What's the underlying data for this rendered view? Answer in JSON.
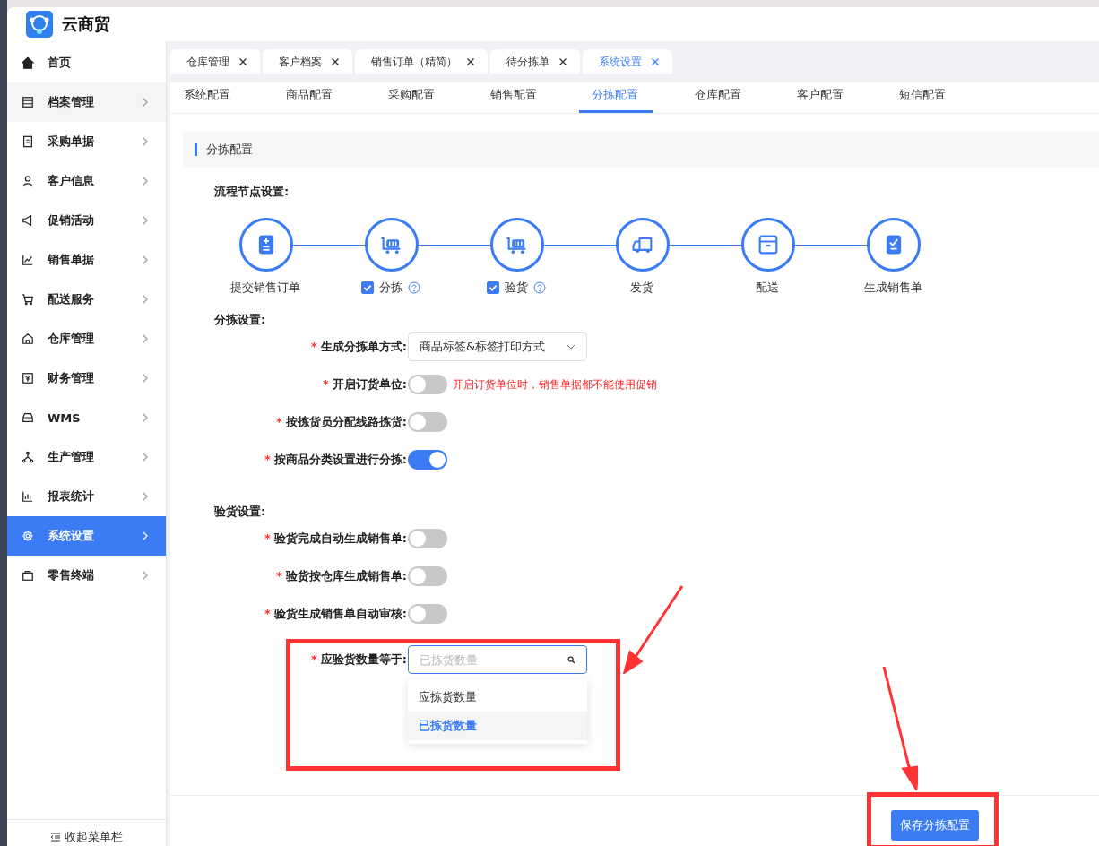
{
  "app": {
    "name": "云商贸"
  },
  "sidebar": {
    "items": [
      {
        "label": "首页",
        "selected": false,
        "expandable": false
      },
      {
        "label": "档案管理",
        "selected": false,
        "expandable": true
      },
      {
        "label": "采购单据",
        "selected": false,
        "expandable": true
      },
      {
        "label": "客户信息",
        "selected": false,
        "expandable": true
      },
      {
        "label": "促销活动",
        "selected": false,
        "expandable": true
      },
      {
        "label": "销售单据",
        "selected": false,
        "expandable": true
      },
      {
        "label": "配送服务",
        "selected": false,
        "expandable": true
      },
      {
        "label": "仓库管理",
        "selected": false,
        "expandable": true
      },
      {
        "label": "财务管理",
        "selected": false,
        "expandable": true
      },
      {
        "label": "WMS",
        "selected": false,
        "expandable": true
      },
      {
        "label": "生产管理",
        "selected": false,
        "expandable": true
      },
      {
        "label": "报表统计",
        "selected": false,
        "expandable": true
      },
      {
        "label": "系统设置",
        "selected": true,
        "expandable": true
      },
      {
        "label": "零售终端",
        "selected": false,
        "expandable": true
      }
    ],
    "collapse_label": "收起菜单栏"
  },
  "tabs": [
    {
      "label": "仓库管理",
      "selected": false
    },
    {
      "label": "客户档案",
      "selected": false
    },
    {
      "label": "销售订单（精简）",
      "selected": false
    },
    {
      "label": "待分拣单",
      "selected": false
    },
    {
      "label": "系统设置",
      "selected": true
    }
  ],
  "sub_tabs": [
    {
      "label": "系统配置",
      "selected": false
    },
    {
      "label": "商品配置",
      "selected": false
    },
    {
      "label": "采购配置",
      "selected": false
    },
    {
      "label": "销售配置",
      "selected": false
    },
    {
      "label": "分拣配置",
      "selected": true
    },
    {
      "label": "仓库配置",
      "selected": false
    },
    {
      "label": "客户配置",
      "selected": false
    },
    {
      "label": "短信配置",
      "selected": false
    }
  ],
  "section_title": "分拣配置",
  "flow": {
    "heading": "流程节点设置:",
    "nodes": [
      {
        "kind": "plain",
        "label": "提交销售订单"
      },
      {
        "kind": "checkbox",
        "label": "分拣",
        "checked": true
      },
      {
        "kind": "checkbox",
        "label": "验货",
        "checked": true
      },
      {
        "kind": "plain",
        "label": "发货"
      },
      {
        "kind": "plain",
        "label": "配送"
      },
      {
        "kind": "plain",
        "label": "生成销售单"
      }
    ]
  },
  "sort_settings": {
    "heading": "分拣设置:",
    "fields": [
      {
        "kind": "select",
        "label": "生成分拣单方式:",
        "required_mark": "*",
        "value": "商品标签&标签打印方式"
      },
      {
        "kind": "switch",
        "label": "开启订货单位:",
        "required_mark": "*",
        "on": false,
        "hint": "开启订货单位时，销售单据都不能使用促销"
      },
      {
        "kind": "switch",
        "label": "按拣货员分配线路拣货:",
        "required_mark": "*",
        "on": false
      },
      {
        "kind": "switch",
        "label": "按商品分类设置进行分拣:",
        "required_mark": "*",
        "on": true
      }
    ]
  },
  "inspect_settings": {
    "heading": "验货设置:",
    "fields": [
      {
        "kind": "switch",
        "label": "验货完成自动生成销售单:",
        "required_mark": "*",
        "on": false
      },
      {
        "kind": "switch",
        "label": "验货按仓库生成销售单:",
        "required_mark": "*",
        "on": false
      },
      {
        "kind": "switch",
        "label": "验货生成销售单自动审核:",
        "required_mark": "*",
        "on": false
      },
      {
        "kind": "search-select",
        "label": "应验货数量等于:",
        "required_mark": "*",
        "placeholder": "已拣货数量",
        "open": true,
        "options": [
          {
            "label": "应拣货数量",
            "selected": false
          },
          {
            "label": "已拣货数量",
            "selected": true
          }
        ]
      }
    ]
  },
  "save_button": "保存分拣配置"
}
